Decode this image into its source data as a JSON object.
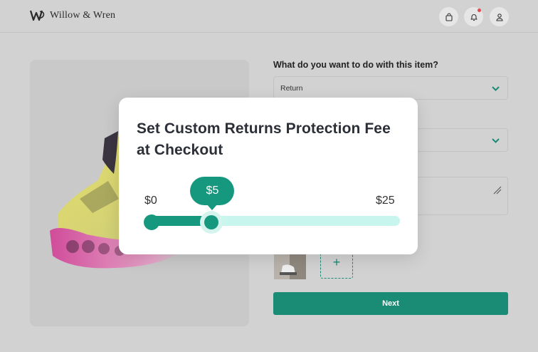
{
  "header": {
    "brand_name": "Willow & Wren",
    "icons": [
      "shopping-bag-icon",
      "bell-icon",
      "user-icon"
    ],
    "has_notification": true
  },
  "form": {
    "question": "What do you want to do with this item?",
    "action_select_value": "Return",
    "next_label": "Next",
    "add_photo_label": "+"
  },
  "modal": {
    "title": "Set Custom Returns Protection Fee at Checkout",
    "slider": {
      "min_label": "$0",
      "max_label": "$25",
      "value_label": "$5",
      "min": 0,
      "max": 25,
      "value": 5
    }
  },
  "colors": {
    "accent": "#16987e",
    "track_light": "#c8f5ee",
    "button": "#1a8b74"
  }
}
